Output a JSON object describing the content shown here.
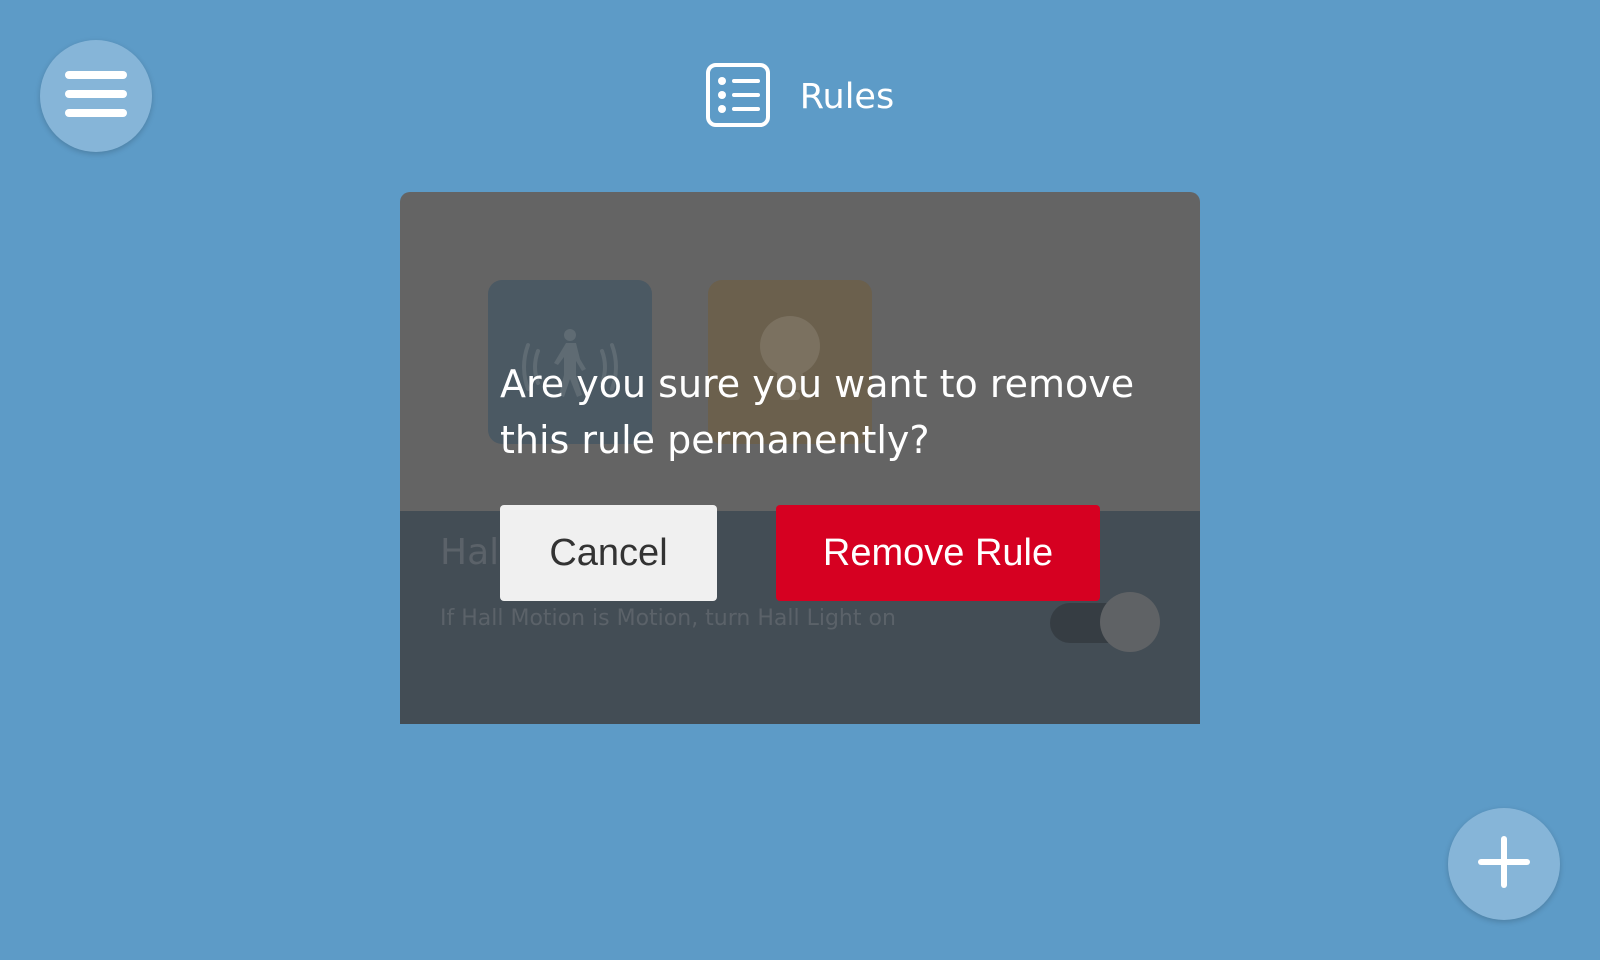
{
  "header": {
    "title": "Rules",
    "icon": "rules-list-icon"
  },
  "menu_button": {
    "icon": "hamburger-menu-icon"
  },
  "add_button": {
    "icon": "plus-icon"
  },
  "rule_card": {
    "name": "Hall Light",
    "description": "If Hall Motion is Motion, turn Hall Light on",
    "trigger_icon": "motion-sensor-icon",
    "action_icon": "light-bulb-icon",
    "enabled": true
  },
  "dialog": {
    "message": "Are you sure you want to remove this rule permanently?",
    "cancel_label": "Cancel",
    "remove_label": "Remove Rule"
  },
  "colors": {
    "background": "#5d9bc7",
    "button_circle": "#86b5d8",
    "remove": "#d60021",
    "cancel": "#f0f0f0"
  }
}
